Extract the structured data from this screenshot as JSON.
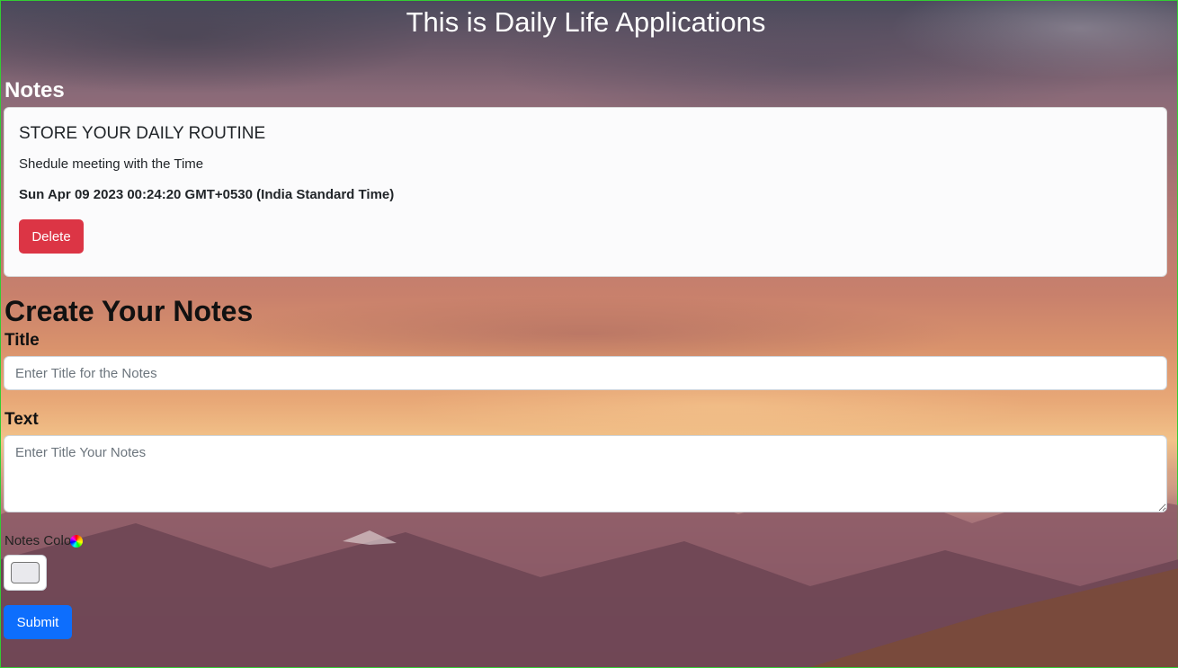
{
  "app": {
    "title": "This is Daily Life Applications"
  },
  "notes_section": {
    "heading": "Notes",
    "notes": [
      {
        "title": "STORE YOUR DAILY ROUTINE",
        "text": "Shedule meeting with the Time",
        "date": "Sun Apr 09 2023 00:24:20 GMT+0530 (India Standard Time)",
        "delete_label": "Delete"
      }
    ]
  },
  "create_section": {
    "heading": "Create Your Notes",
    "title_label": "Title",
    "title_placeholder": "Enter Title for the Notes",
    "title_value": "",
    "text_label": "Text",
    "text_placeholder": "Enter Title Your Notes",
    "text_value": "",
    "color_label": "Notes Color",
    "color_icon": "color-wheel-icon",
    "color_value": "#e9e9ed",
    "submit_label": "Submit"
  },
  "colors": {
    "delete": "#dc3545",
    "submit": "#0d6efd",
    "border_frame": "#33cc33"
  }
}
